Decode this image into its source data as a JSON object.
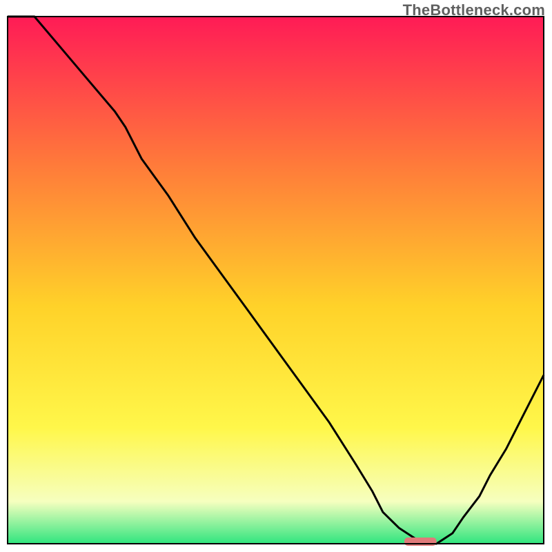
{
  "watermark": "TheBottleneck.com",
  "colors": {
    "grad_top": "#ff1b56",
    "grad_mid_upper": "#ff7a3a",
    "grad_mid": "#ffd229",
    "grad_mid_lower": "#fff74a",
    "grad_pale": "#f6ffbf",
    "grad_green": "#2fe57e",
    "curve": "#000000",
    "marker": "#e07a7a",
    "frame": "#000000"
  },
  "plot": {
    "x_min": 11,
    "x_max": 788,
    "y_top": 24,
    "y_bottom": 788
  },
  "chart_data": {
    "type": "line",
    "title": "",
    "xlabel": "",
    "ylabel": "",
    "xlim": [
      0,
      100
    ],
    "ylim": [
      0,
      100
    ],
    "x": [
      0,
      5,
      10,
      15,
      20,
      22,
      25,
      30,
      35,
      40,
      45,
      50,
      55,
      60,
      65,
      68,
      70,
      73,
      76,
      78,
      80,
      83,
      85,
      88,
      90,
      93,
      96,
      100
    ],
    "values": [
      105,
      100,
      94,
      88,
      82,
      79,
      73,
      66,
      58,
      51,
      44,
      37,
      30,
      23,
      15,
      10,
      6,
      3,
      1,
      0,
      0,
      2,
      5,
      9,
      13,
      18,
      24,
      32
    ],
    "marker": {
      "x_start": 74,
      "x_end": 80,
      "y": 0
    }
  }
}
